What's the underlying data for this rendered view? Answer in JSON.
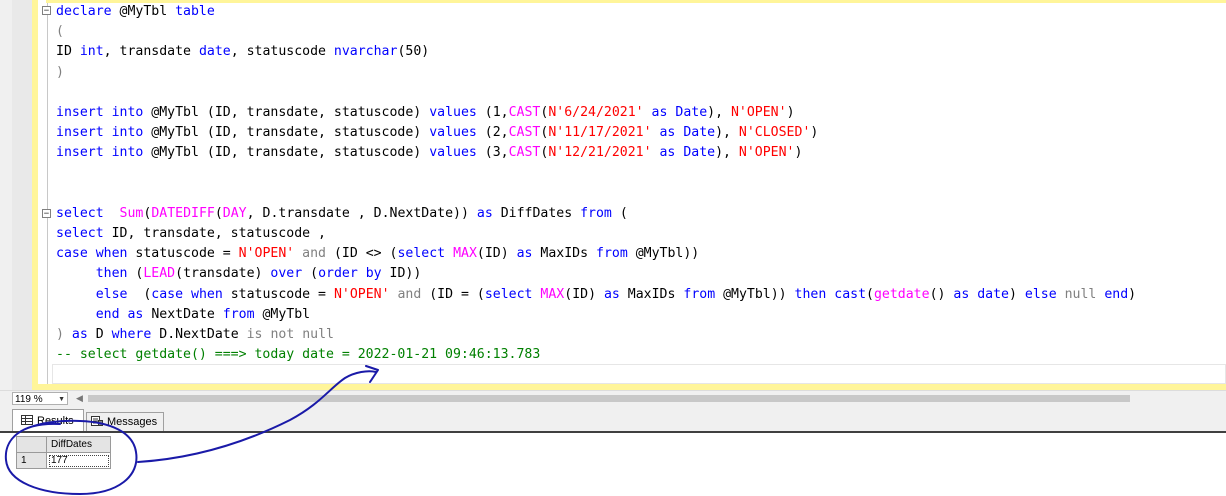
{
  "editor": {
    "lines": [
      [
        {
          "t": "declare",
          "c": "kw"
        },
        {
          "t": " @MyTbl ",
          "c": ""
        },
        {
          "t": "table",
          "c": "kw"
        }
      ],
      [
        {
          "t": "(",
          "c": "gray"
        }
      ],
      [
        {
          "t": "ID ",
          "c": ""
        },
        {
          "t": "int",
          "c": "kw"
        },
        {
          "t": ", transdate ",
          "c": ""
        },
        {
          "t": "date",
          "c": "kw"
        },
        {
          "t": ", statuscode ",
          "c": ""
        },
        {
          "t": "nvarchar",
          "c": "kw"
        },
        {
          "t": "(50)",
          "c": ""
        }
      ],
      [
        {
          "t": ")",
          "c": "gray"
        }
      ],
      [],
      [
        {
          "t": "insert",
          "c": "kw"
        },
        {
          "t": " ",
          "c": ""
        },
        {
          "t": "into",
          "c": "kw"
        },
        {
          "t": " @MyTbl (ID, transdate, statuscode) ",
          "c": ""
        },
        {
          "t": "values",
          "c": "kw"
        },
        {
          "t": " (1,",
          "c": ""
        },
        {
          "t": "CAST",
          "c": "fn"
        },
        {
          "t": "(",
          "c": ""
        },
        {
          "t": "N'6/24/2021'",
          "c": "str"
        },
        {
          "t": " ",
          "c": ""
        },
        {
          "t": "as",
          "c": "kw"
        },
        {
          "t": " ",
          "c": ""
        },
        {
          "t": "Date",
          "c": "kw"
        },
        {
          "t": "), ",
          "c": ""
        },
        {
          "t": "N'OPEN'",
          "c": "str"
        },
        {
          "t": ")",
          "c": ""
        }
      ],
      [
        {
          "t": "insert",
          "c": "kw"
        },
        {
          "t": " ",
          "c": ""
        },
        {
          "t": "into",
          "c": "kw"
        },
        {
          "t": " @MyTbl (ID, transdate, statuscode) ",
          "c": ""
        },
        {
          "t": "values",
          "c": "kw"
        },
        {
          "t": " (2,",
          "c": ""
        },
        {
          "t": "CAST",
          "c": "fn"
        },
        {
          "t": "(",
          "c": ""
        },
        {
          "t": "N'11/17/2021'",
          "c": "str"
        },
        {
          "t": " ",
          "c": ""
        },
        {
          "t": "as",
          "c": "kw"
        },
        {
          "t": " ",
          "c": ""
        },
        {
          "t": "Date",
          "c": "kw"
        },
        {
          "t": "), ",
          "c": ""
        },
        {
          "t": "N'CLOSED'",
          "c": "str"
        },
        {
          "t": ")",
          "c": ""
        }
      ],
      [
        {
          "t": "insert",
          "c": "kw"
        },
        {
          "t": " ",
          "c": ""
        },
        {
          "t": "into",
          "c": "kw"
        },
        {
          "t": " @MyTbl (ID, transdate, statuscode) ",
          "c": ""
        },
        {
          "t": "values",
          "c": "kw"
        },
        {
          "t": " (3,",
          "c": ""
        },
        {
          "t": "CAST",
          "c": "fn"
        },
        {
          "t": "(",
          "c": ""
        },
        {
          "t": "N'12/21/2021'",
          "c": "str"
        },
        {
          "t": " ",
          "c": ""
        },
        {
          "t": "as",
          "c": "kw"
        },
        {
          "t": " ",
          "c": ""
        },
        {
          "t": "Date",
          "c": "kw"
        },
        {
          "t": "), ",
          "c": ""
        },
        {
          "t": "N'OPEN'",
          "c": "str"
        },
        {
          "t": ")",
          "c": ""
        }
      ],
      [],
      [],
      [
        {
          "t": "select",
          "c": "kw"
        },
        {
          "t": "  ",
          "c": ""
        },
        {
          "t": "Sum",
          "c": "fn"
        },
        {
          "t": "(",
          "c": ""
        },
        {
          "t": "DATEDIFF",
          "c": "fn"
        },
        {
          "t": "(",
          "c": ""
        },
        {
          "t": "DAY",
          "c": "fn"
        },
        {
          "t": ", D.transdate , D.NextDate)) ",
          "c": ""
        },
        {
          "t": "as",
          "c": "kw"
        },
        {
          "t": " DiffDates ",
          "c": ""
        },
        {
          "t": "from",
          "c": "kw"
        },
        {
          "t": " (",
          "c": ""
        }
      ],
      [
        {
          "t": "select",
          "c": "kw"
        },
        {
          "t": " ID, transdate, statuscode ,",
          "c": ""
        }
      ],
      [
        {
          "t": "case",
          "c": "kw"
        },
        {
          "t": " ",
          "c": ""
        },
        {
          "t": "when",
          "c": "kw"
        },
        {
          "t": " statuscode = ",
          "c": ""
        },
        {
          "t": "N'OPEN'",
          "c": "str"
        },
        {
          "t": " ",
          "c": ""
        },
        {
          "t": "and",
          "c": "gray"
        },
        {
          "t": " (ID <> (",
          "c": ""
        },
        {
          "t": "select",
          "c": "kw"
        },
        {
          "t": " ",
          "c": ""
        },
        {
          "t": "MAX",
          "c": "fn"
        },
        {
          "t": "(ID) ",
          "c": ""
        },
        {
          "t": "as",
          "c": "kw"
        },
        {
          "t": " MaxIDs ",
          "c": ""
        },
        {
          "t": "from",
          "c": "kw"
        },
        {
          "t": " @MyTbl))",
          "c": ""
        }
      ],
      [
        {
          "t": "     ",
          "c": ""
        },
        {
          "t": "then",
          "c": "kw"
        },
        {
          "t": " (",
          "c": ""
        },
        {
          "t": "LEAD",
          "c": "fn"
        },
        {
          "t": "(transdate) ",
          "c": ""
        },
        {
          "t": "over",
          "c": "kw"
        },
        {
          "t": " (",
          "c": ""
        },
        {
          "t": "order",
          "c": "kw"
        },
        {
          "t": " ",
          "c": ""
        },
        {
          "t": "by",
          "c": "kw"
        },
        {
          "t": " ID))",
          "c": ""
        }
      ],
      [
        {
          "t": "     ",
          "c": ""
        },
        {
          "t": "else",
          "c": "kw"
        },
        {
          "t": "  (",
          "c": ""
        },
        {
          "t": "case",
          "c": "kw"
        },
        {
          "t": " ",
          "c": ""
        },
        {
          "t": "when",
          "c": "kw"
        },
        {
          "t": " statuscode = ",
          "c": ""
        },
        {
          "t": "N'OPEN'",
          "c": "str"
        },
        {
          "t": " ",
          "c": ""
        },
        {
          "t": "and",
          "c": "gray"
        },
        {
          "t": " (ID = (",
          "c": ""
        },
        {
          "t": "select",
          "c": "kw"
        },
        {
          "t": " ",
          "c": ""
        },
        {
          "t": "MAX",
          "c": "fn"
        },
        {
          "t": "(ID) ",
          "c": ""
        },
        {
          "t": "as",
          "c": "kw"
        },
        {
          "t": " MaxIDs ",
          "c": ""
        },
        {
          "t": "from",
          "c": "kw"
        },
        {
          "t": " @MyTbl)) ",
          "c": ""
        },
        {
          "t": "then",
          "c": "kw"
        },
        {
          "t": " ",
          "c": ""
        },
        {
          "t": "cast",
          "c": "kw"
        },
        {
          "t": "(",
          "c": ""
        },
        {
          "t": "getdate",
          "c": "fn"
        },
        {
          "t": "() ",
          "c": ""
        },
        {
          "t": "as",
          "c": "kw"
        },
        {
          "t": " ",
          "c": ""
        },
        {
          "t": "date",
          "c": "kw"
        },
        {
          "t": ") ",
          "c": ""
        },
        {
          "t": "else",
          "c": "kw"
        },
        {
          "t": " ",
          "c": ""
        },
        {
          "t": "null",
          "c": "gray"
        },
        {
          "t": " ",
          "c": ""
        },
        {
          "t": "end",
          "c": "kw"
        },
        {
          "t": ")",
          "c": ""
        }
      ],
      [
        {
          "t": "     ",
          "c": ""
        },
        {
          "t": "end",
          "c": "kw"
        },
        {
          "t": " ",
          "c": ""
        },
        {
          "t": "as",
          "c": "kw"
        },
        {
          "t": " NextDate ",
          "c": ""
        },
        {
          "t": "from",
          "c": "kw"
        },
        {
          "t": " @MyTbl",
          "c": ""
        }
      ],
      [
        {
          "t": ") ",
          "c": "gray"
        },
        {
          "t": "as",
          "c": "kw"
        },
        {
          "t": " D ",
          "c": ""
        },
        {
          "t": "where",
          "c": "kw"
        },
        {
          "t": " D.NextDate ",
          "c": ""
        },
        {
          "t": "is",
          "c": "gray"
        },
        {
          "t": " ",
          "c": ""
        },
        {
          "t": "not",
          "c": "gray"
        },
        {
          "t": " ",
          "c": ""
        },
        {
          "t": "null",
          "c": "gray"
        }
      ],
      [
        {
          "t": "-- select getdate() ===> today date = 2022-01-21 09:46:13.783",
          "c": "cm"
        }
      ],
      []
    ]
  },
  "zoom": {
    "value": "119 %"
  },
  "tabs": {
    "results_label": "Results",
    "messages_label": "Messages"
  },
  "grid": {
    "columns": [
      "DiffDates"
    ],
    "rows": [
      {
        "num": "1",
        "values": [
          "177"
        ]
      }
    ]
  },
  "colors": {
    "keyword": "#0000ff",
    "function": "#ff00ff",
    "string": "#ff0000",
    "comment": "#008000",
    "operator": "#808080",
    "annotation": "#1a1aa8"
  }
}
